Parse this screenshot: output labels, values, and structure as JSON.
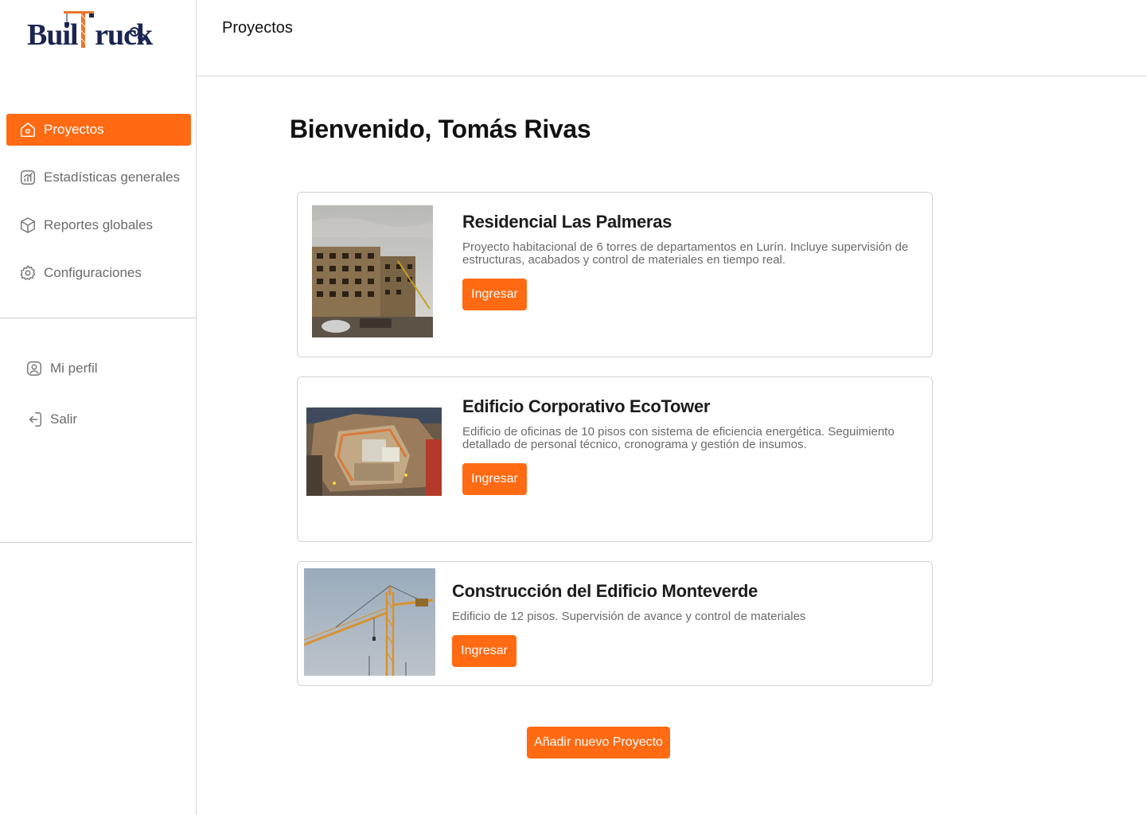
{
  "brand": {
    "name": "BuilTruck",
    "accent": "#ff6a13",
    "logo_color": "#1a2550"
  },
  "sidebar": {
    "items": [
      {
        "label": "Proyectos",
        "icon": "home-icon",
        "active": true
      },
      {
        "label": "Estadísticas generales",
        "icon": "chart-icon",
        "active": false
      },
      {
        "label": "Reportes globales",
        "icon": "box-icon",
        "active": false
      },
      {
        "label": "Configuraciones",
        "icon": "gear-icon",
        "active": false
      }
    ],
    "secondary": [
      {
        "label": "Mi perfil",
        "icon": "user-icon"
      },
      {
        "label": "Salir",
        "icon": "logout-icon"
      }
    ]
  },
  "header": {
    "title": "Proyectos"
  },
  "main": {
    "welcome": "Bienvenido, Tomás Rivas",
    "projects": [
      {
        "title": "Residencial Las Palmeras",
        "description": "Proyecto habitacional de 6 torres de departamentos en Lurín. Incluye supervisión de estructuras, acabados y control de materiales en tiempo real.",
        "button": "Ingresar",
        "image": "apartment-building-photo"
      },
      {
        "title": "Edificio Corporativo EcoTower",
        "description": "Edificio de oficinas de 10 pisos con sistema de eficiencia energética. Seguimiento detallado de personal técnico, cronograma y gestión de insumos.",
        "button": "Ingresar",
        "image": "construction-site-aerial-photo"
      },
      {
        "title": "Construcción del Edificio Monteverde",
        "description": "Edificio de 12 pisos. Supervisión de avance y control de materiales",
        "button": "Ingresar",
        "image": "tower-crane-photo"
      }
    ],
    "add_button": "Añadir nuevo Proyecto"
  }
}
